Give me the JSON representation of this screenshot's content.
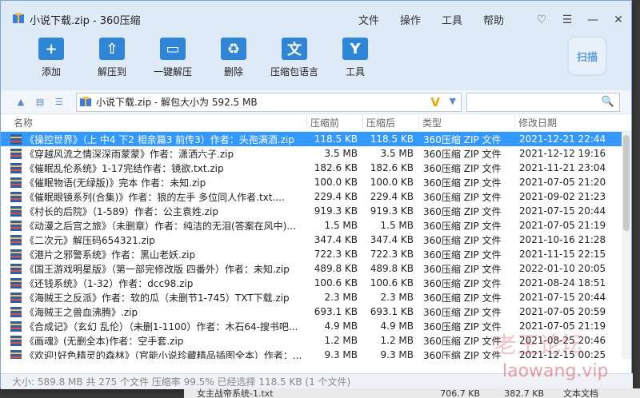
{
  "window": {
    "title": "小说下载.zip - 360压缩"
  },
  "menu": [
    "文件",
    "操作",
    "工具",
    "帮助"
  ],
  "sys_buttons": [
    "♡",
    "☰",
    "—",
    "✕"
  ],
  "toolbar": {
    "tools": [
      {
        "label": "添加",
        "icon": "add-icon",
        "glyph": "+"
      },
      {
        "label": "解压到",
        "icon": "extract-to-icon",
        "glyph": "⇧"
      },
      {
        "label": "一键解压",
        "icon": "one-click-extract-icon",
        "glyph": "▭"
      },
      {
        "label": "删除",
        "icon": "delete-icon",
        "glyph": "♻"
      },
      {
        "label": "压缩包语言",
        "icon": "language-icon",
        "glyph": "文"
      },
      {
        "label": "工具",
        "icon": "tools-icon",
        "glyph": "Y"
      }
    ],
    "scan_label": "扫描"
  },
  "address": {
    "text": "小说下载.zip - 解包大小为 592.5 MB"
  },
  "search": {
    "placeholder": ""
  },
  "columns": {
    "name": "名称",
    "size": "压缩前",
    "compressed": "压缩后",
    "type": "类型",
    "date": "修改日期"
  },
  "files": [
    {
      "name": "《操控世界》（上 中4 下2 相亲篇3 前传3）作者：头孢满酒.zip",
      "size": "118.5 KB",
      "compressed": "118.5 KB",
      "type": "360压缩 ZIP 文件",
      "date": "2021-12-21 22:44",
      "selected": true
    },
    {
      "name": "《穿越风流之情深深雨蒙蒙》作者：潇洒六子.zip",
      "size": "3.5 MB",
      "compressed": "3.5 MB",
      "type": "360压缩 ZIP 文件",
      "date": "2021-12-12 19:16"
    },
    {
      "name": "《催眠乱伦系统》1-17完结作者：镜欲.txt.zip",
      "size": "182.6 KB",
      "compressed": "182.6 KB",
      "type": "360压缩 ZIP 文件",
      "date": "2021-11-21 23:04"
    },
    {
      "name": "《催眠物语(无绿版)》完本 作者：未知.zip",
      "size": "100.0 KB",
      "compressed": "100.0 KB",
      "type": "360压缩 ZIP 文件",
      "date": "2021-07-05 21:20"
    },
    {
      "name": "《催眠眼镜系列(合集)》作者：狼的左手 多位同人作者.txt....",
      "size": "229.4 KB",
      "compressed": "229.4 KB",
      "type": "360压缩 ZIP 文件",
      "date": "2021-09-02 21:23"
    },
    {
      "name": "《村长的后院》（1-589）作者：公主袁姓.zip",
      "size": "919.3 KB",
      "compressed": "919.3 KB",
      "type": "360压缩 ZIP 文件",
      "date": "2021-07-15 20:44"
    },
    {
      "name": "《动漫之后宫之旅》（未删章）作者：纯洁的无泪(答案在风中)...",
      "size": "1.5 MB",
      "compressed": "1.5 MB",
      "type": "360压缩 ZIP 文件",
      "date": "2021-07-05 21:19"
    },
    {
      "name": "《二次元》解压码654321.zip",
      "size": "347.4 KB",
      "compressed": "347.4 KB",
      "type": "360压缩 ZIP 文件",
      "date": "2021-10-16 21:28"
    },
    {
      "name": "《港片之邪警系统》作者：黑山老妖.zip",
      "size": "722.3 KB",
      "compressed": "722.3 KB",
      "type": "360压缩 ZIP 文件",
      "date": "2021-11-15 22:15"
    },
    {
      "name": "《国王游戏明星版》（第一部完修改版 四番外）作者：未知.zip",
      "size": "489.8 KB",
      "compressed": "489.8 KB",
      "type": "360压缩 ZIP 文件",
      "date": "2022-01-10 20:05"
    },
    {
      "name": "《还钱系统》（1-32）作者：dcc98.zip",
      "size": "100.6 KB",
      "compressed": "100.6 KB",
      "type": "360压缩 ZIP 文件",
      "date": "2021-08-24 18:51"
    },
    {
      "name": "《海贼王之反派》作者：软的瓜（未删节1-745）TXT下载.zip",
      "size": "2.3 MB",
      "compressed": "2.3 MB",
      "type": "360压缩 ZIP 文件",
      "date": "2021-07-15 20:44"
    },
    {
      "name": "《海贼王之兽血沸腾》.zip",
      "size": "693.1 KB",
      "compressed": "693.1 KB",
      "type": "360压缩 ZIP 文件",
      "date": "2021-07-05 20:59"
    },
    {
      "name": "《合成记》（玄幻 乱伦）（未删1-1100）作者：木石64-搜书吧...",
      "size": "4.9 MB",
      "compressed": "4.9 MB",
      "type": "360压缩 ZIP 文件",
      "date": "2021-07-05 21:19"
    },
    {
      "name": "《画魂》(无删全本)作者：空手套.zip",
      "size": "1.2 MB",
      "compressed": "1.2 MB",
      "type": "360压缩 ZIP 文件",
      "date": "2021-08-25 20:46"
    },
    {
      "name": "《欢迎!好色精灵的森林》（官能小说珍藏精品插图全本）作者：...",
      "size": "9.3 MB",
      "compressed": "9.3 MB",
      "type": "360压缩 ZIP 文件",
      "date": "2021-12-15 00:25"
    }
  ],
  "status": {
    "text": "大小: 589.8 MB 共 275 个文件 压缩率 99.5% 已经选择 118.5 KB (1 个文件)"
  },
  "background_row": {
    "name": "女主战帝系统-1.txt",
    "size": "706.7 KB",
    "compressed": "382.7 KB",
    "type": "文本文档"
  },
  "watermark": {
    "line1": "老王论坛",
    "line2": "laowang.vip"
  },
  "colors": {
    "selection": "#3399ff",
    "toolbar_bg": "#dfeaf7",
    "icon_blue": "#2f86d6"
  }
}
